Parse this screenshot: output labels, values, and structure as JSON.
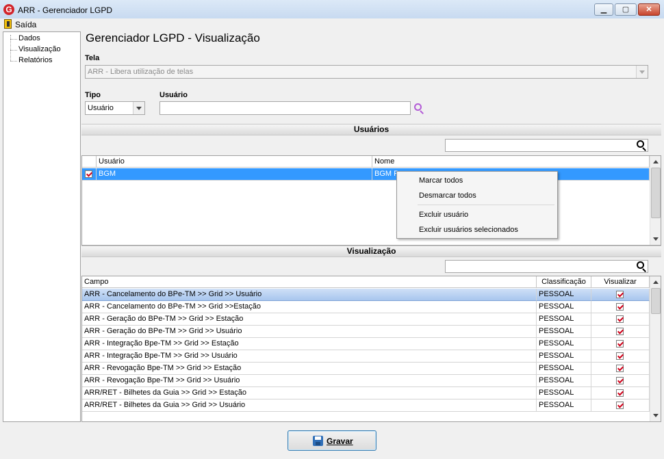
{
  "window": {
    "title": "ARR - Gerenciador LGPD",
    "logo_letter": "G",
    "minimize_glyph": "▁",
    "maximize_glyph": "▢",
    "close_glyph": "✕"
  },
  "menu": {
    "exit_label": "Saída"
  },
  "tree": {
    "items": [
      "Dados",
      "Visualização",
      "Relatórios"
    ]
  },
  "page_title": "Gerenciador LGPD - Visualização",
  "tela": {
    "label": "Tela",
    "value": "ARR - Libera utilização de telas"
  },
  "tipo": {
    "label": "Tipo",
    "value": "Usuário"
  },
  "usuario_field": {
    "label": "Usuário",
    "value": ""
  },
  "users_section": {
    "title": "Usuários",
    "search_value": "",
    "columns": [
      "Usuário",
      "Nome"
    ],
    "rows": [
      {
        "checked": true,
        "usuario": "BGM",
        "nome": "BGM P"
      }
    ]
  },
  "context_menu": {
    "items": [
      "Marcar todos",
      "Desmarcar todos",
      "Excluir usuário",
      "Excluir usuários selecionados"
    ]
  },
  "view_section": {
    "title": "Visualização",
    "search_value": "",
    "columns": [
      "Campo",
      "Classificação",
      "Visualizar"
    ],
    "rows": [
      {
        "campo": "ARR - Cancelamento do BPe-TM >> Grid >> Usuário",
        "classificacao": "PESSOAL",
        "visualizar": true
      },
      {
        "campo": "ARR - Cancelamento do BPe-TM >> Grid >>Estação",
        "classificacao": "PESSOAL",
        "visualizar": true
      },
      {
        "campo": "ARR - Geração do BPe-TM >> Grid >> Estação",
        "classificacao": "PESSOAL",
        "visualizar": true
      },
      {
        "campo": "ARR - Geração do BPe-TM >> Grid >> Usuário",
        "classificacao": "PESSOAL",
        "visualizar": true
      },
      {
        "campo": "ARR - Integração Bpe-TM >> Grid >> Estação",
        "classificacao": "PESSOAL",
        "visualizar": true
      },
      {
        "campo": "ARR - Integração Bpe-TM >> Grid >> Usuário",
        "classificacao": "PESSOAL",
        "visualizar": true
      },
      {
        "campo": "ARR - Revogação Bpe-TM >> Grid >> Estação",
        "classificacao": "PESSOAL",
        "visualizar": true
      },
      {
        "campo": "ARR - Revogação Bpe-TM >> Grid >> Usuário",
        "classificacao": "PESSOAL",
        "visualizar": true
      },
      {
        "campo": "ARR/RET - Bilhetes da Guia >> Grid >> Estação",
        "classificacao": "PESSOAL",
        "visualizar": true
      },
      {
        "campo": "ARR/RET - Bilhetes da Guia >> Grid >> Usuário",
        "classificacao": "PESSOAL",
        "visualizar": true
      }
    ]
  },
  "save_button": {
    "label": "Gravar"
  },
  "colors": {
    "selection_blue": "#3399ff",
    "check_red": "#d0021b",
    "search_purple": "#b35cd6"
  }
}
